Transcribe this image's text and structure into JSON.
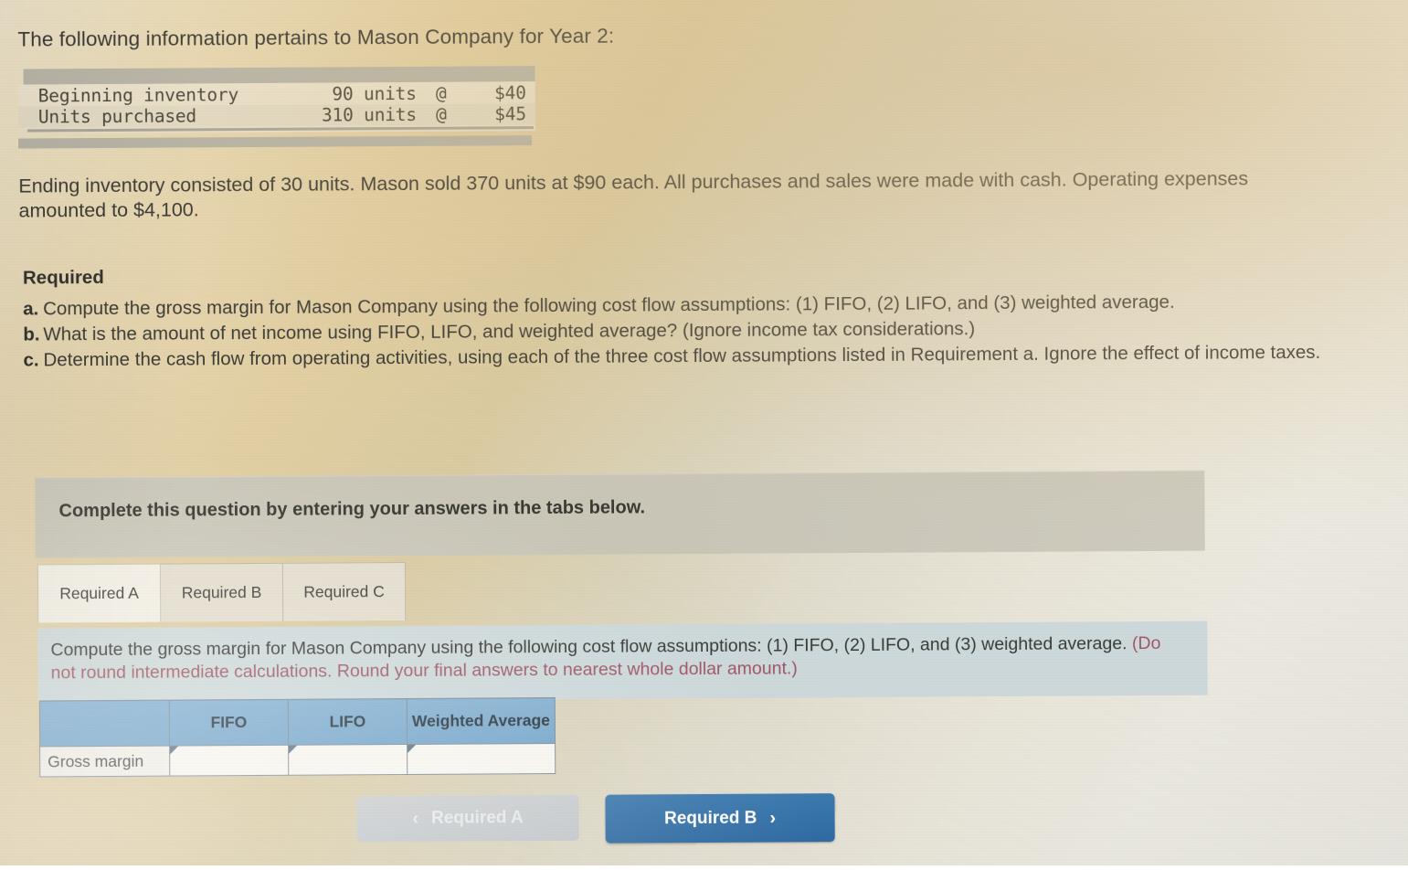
{
  "intro": "The following information pertains to Mason Company for Year 2:",
  "inventory_table": {
    "rows": [
      {
        "label": "Beginning inventory",
        "units": "90 units",
        "at": "@",
        "price": "$40"
      },
      {
        "label": "Units purchased",
        "units": "310 units",
        "at": "@",
        "price": "$45"
      }
    ]
  },
  "ending_paragraph": "Ending inventory consisted of 30 units. Mason sold 370 units at $90 each. All purchases and sales were made with cash. Operating expenses amounted to $4,100.",
  "required_heading": "Required",
  "required_items": [
    {
      "marker": "a.",
      "text": "Compute the gross margin for Mason Company using the following cost flow assumptions: (1) FIFO, (2) LIFO, and (3) weighted average."
    },
    {
      "marker": "b.",
      "text": "What is the amount of net income using FIFO, LIFO, and weighted average? (Ignore income tax considerations.)"
    },
    {
      "marker": "c.",
      "text": "Determine the cash flow from operating activities, using each of the three cost flow assumptions listed in Requirement a. Ignore the effect of income taxes."
    }
  ],
  "grey_banner": "Complete this question by entering your answers in the tabs below.",
  "tabs": [
    {
      "label": "Required A",
      "active": true
    },
    {
      "label": "Required B",
      "active": false
    },
    {
      "label": "Required C",
      "active": false
    }
  ],
  "requirement_description": {
    "main": "Compute the gross margin for Mason Company using the following cost flow assumptions: (1) FIFO, (2) LIFO, and (3) weighted average. ",
    "hint": "(Do not round intermediate calculations. Round your final answers to nearest whole dollar amount.)"
  },
  "answer_grid": {
    "headers": [
      "",
      "FIFO",
      "LIFO",
      "Weighted Average"
    ],
    "rows": [
      {
        "label": "Gross margin",
        "values": [
          "",
          "",
          ""
        ]
      }
    ]
  },
  "nav": {
    "prev_label": "Required A",
    "prev_chevron": "‹",
    "next_label": "Required B",
    "next_chevron": "›"
  },
  "colors": {
    "header_blue": "#73a5c9",
    "button_blue": "#2f6aa2",
    "button_disabled": "#c5c9cb",
    "banner_grey": "#c9c6b8",
    "desc_bluegrey": "#ccd8da",
    "hint_red": "#9f5565"
  }
}
